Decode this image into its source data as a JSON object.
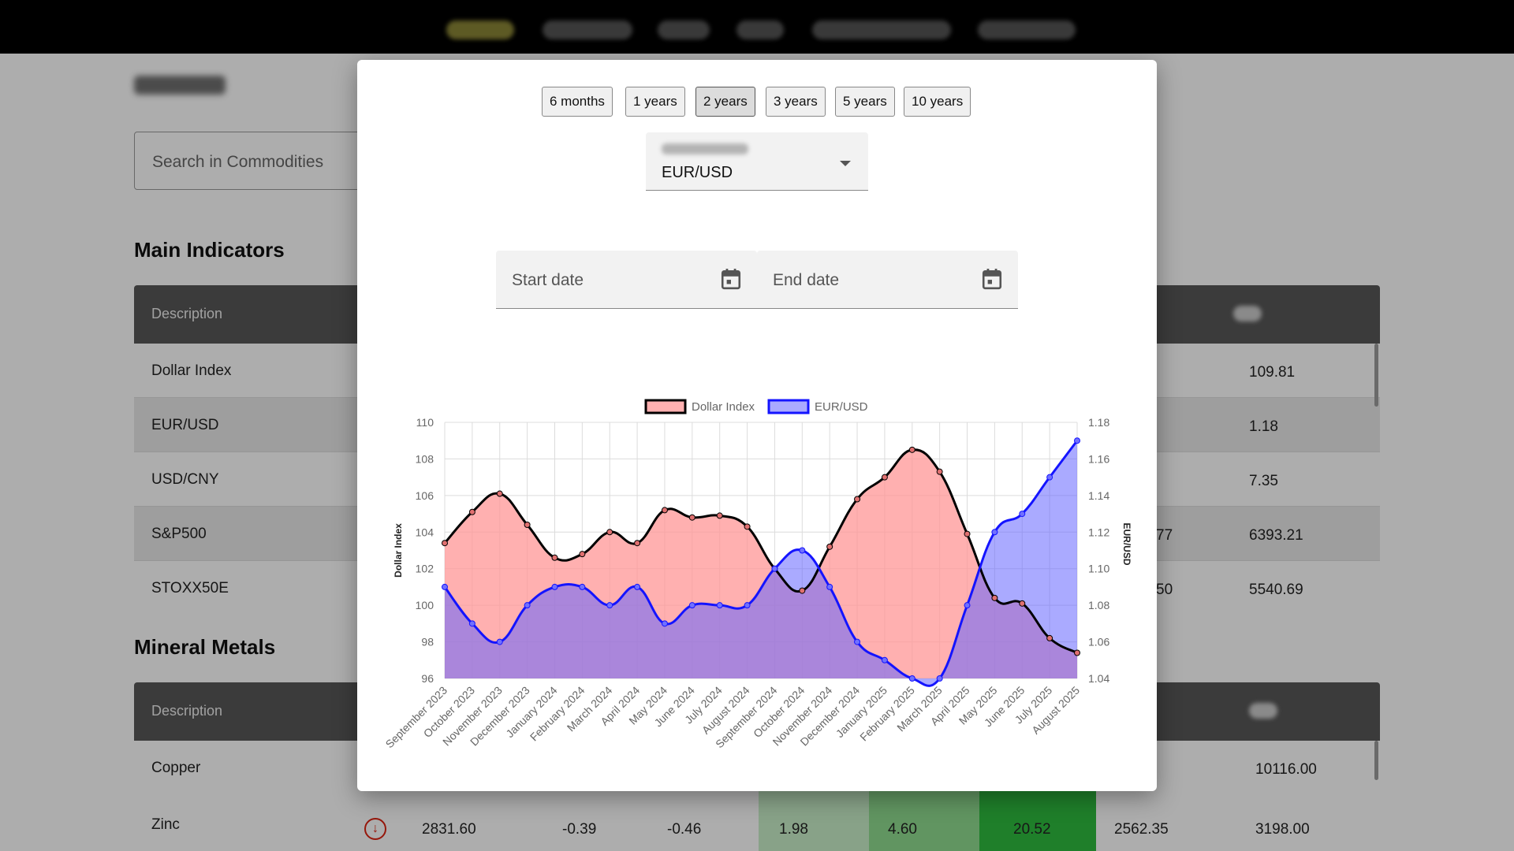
{
  "background": {
    "search_placeholder": "Search in Commodities",
    "main_indicators": {
      "title": "Main Indicators",
      "header": "Description",
      "rows": [
        {
          "description": "Dollar Index",
          "mid": "",
          "value": "109.81"
        },
        {
          "description": "EUR/USD",
          "mid": "",
          "value": "1.18"
        },
        {
          "description": "USD/CNY",
          "mid": "",
          "value": "7.35"
        },
        {
          "description": "S&P500",
          "mid": "77",
          "value": "6393.21"
        },
        {
          "description": "STOXX50E",
          "mid": "50",
          "value": "5540.69"
        }
      ]
    },
    "mineral_metals": {
      "title": "Mineral Metals",
      "header": "Description",
      "rows": [
        {
          "description": "Copper",
          "value": "10116.00"
        }
      ],
      "zinc": {
        "description": "Zinc",
        "cells": [
          "2831.60",
          "-0.39",
          "-0.46",
          "1.98",
          "4.60",
          "20.52",
          "2562.35",
          "3198.00"
        ]
      }
    }
  },
  "modal": {
    "ranges": [
      "6 months",
      "1 years",
      "2 years",
      "3 years",
      "5 years",
      "10 years"
    ],
    "active_range": "2 years",
    "select_value": "EUR/USD",
    "start_date_placeholder": "Start date",
    "end_date_placeholder": "End date",
    "icons": {
      "date_picker": "calendar-icon",
      "dropdown": "chevron-down-icon",
      "zinc_trend": "arrow-down-circle-icon"
    }
  },
  "chart_data": {
    "type": "line",
    "title": "",
    "legend_position": "top-center",
    "grid": true,
    "categories": [
      "September 2023",
      "October 2023",
      "November 2023",
      "December 2023",
      "January 2024",
      "February 2024",
      "March 2024",
      "April 2024",
      "May 2024",
      "June 2024",
      "July 2024",
      "August 2024",
      "September 2024",
      "October 2024",
      "November 2024",
      "December 2024",
      "January 2025",
      "February 2025",
      "March 2025",
      "April 2025",
      "May 2025",
      "June 2025",
      "July 2025",
      "August 2025"
    ],
    "series": [
      {
        "name": "Dollar Index",
        "axis": "left",
        "color": "#000000",
        "fill": "rgba(255,150,150,0.75)",
        "values": [
          103.4,
          105.1,
          106.1,
          104.4,
          102.6,
          102.8,
          104.0,
          103.4,
          105.2,
          104.8,
          104.9,
          104.3,
          102.0,
          100.8,
          103.2,
          105.8,
          107.0,
          108.5,
          107.3,
          103.9,
          100.4,
          100.1,
          98.2,
          97.4
        ]
      },
      {
        "name": "EUR/USD",
        "axis": "right",
        "color": "#1414ff",
        "fill": "rgba(100,100,255,0.55)",
        "values": [
          1.09,
          1.07,
          1.06,
          1.08,
          1.09,
          1.09,
          1.08,
          1.09,
          1.07,
          1.08,
          1.08,
          1.08,
          1.1,
          1.11,
          1.09,
          1.06,
          1.05,
          1.04,
          1.04,
          1.08,
          1.12,
          1.13,
          1.15,
          1.17
        ]
      }
    ],
    "ylabel_left": "Dollar Index",
    "ylabel_right": "EUR/USD",
    "ylim_left": [
      96,
      110
    ],
    "yticks_left": [
      96,
      98,
      100,
      102,
      104,
      106,
      108,
      110
    ],
    "ylim_right": [
      1.04,
      1.18
    ],
    "yticks_right": [
      "1.04",
      "1.06",
      "1.08",
      "1.10",
      "1.12",
      "1.14",
      "1.16",
      "1.18"
    ]
  },
  "colors": {
    "topbar": "#000000",
    "table_header": "#575757",
    "accent_green": "#2fbc3f",
    "down_red": "#dd2211"
  }
}
